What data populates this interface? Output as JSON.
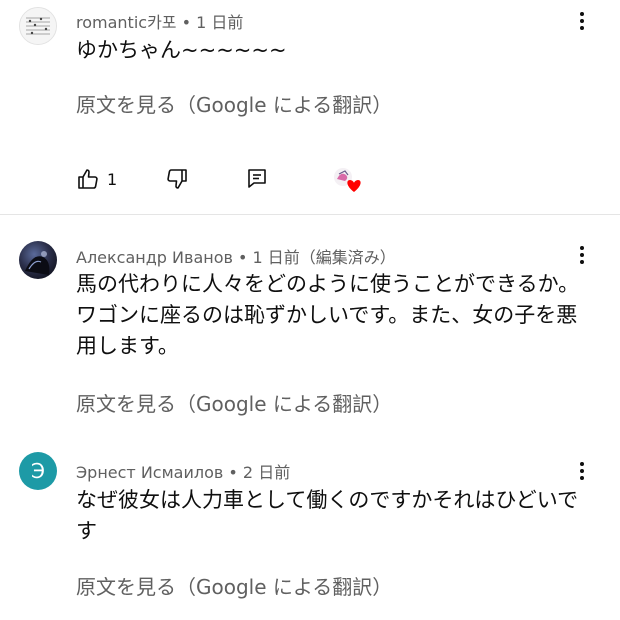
{
  "comments": [
    {
      "author": "romantic카포",
      "time": "1 日前",
      "meta": "romantic카포 • 1 日前",
      "text": "ゆかちゃん~~~~~~",
      "translate_label": "原文を見る（Google による翻訳）",
      "likes": "1",
      "hearted": true
    },
    {
      "author": "Александр Иванов",
      "time": "1 日前",
      "meta": "Александр Иванов • 1 日前（編集済み）",
      "text": "馬の代わりに人々をどのように使うことができるか。ワゴンに座るのは恥ずかしいです。また、女の子を悪用します。",
      "translate_label": "原文を見る（Google による翻訳）"
    },
    {
      "author": "Эрнест Исмаилов",
      "time": "2 日前",
      "meta": "Эрнест Исмаилов • 2 日前",
      "avatar_letter": "Э",
      "text": "なぜ彼女は人力車として働くのですかそれはひどいです",
      "translate_label": "原文を見る（Google による翻訳）"
    }
  ],
  "icons": {
    "like": "thumb-up-outline",
    "dislike": "thumb-down-outline",
    "reply": "comment-outline",
    "heart": "creator-heart",
    "menu": "more-vertical"
  },
  "colors": {
    "meta_text": "#606060",
    "body_text": "#0f0f0f",
    "letter_avatar": "#1d9aa6",
    "heart": "#ff0000"
  }
}
